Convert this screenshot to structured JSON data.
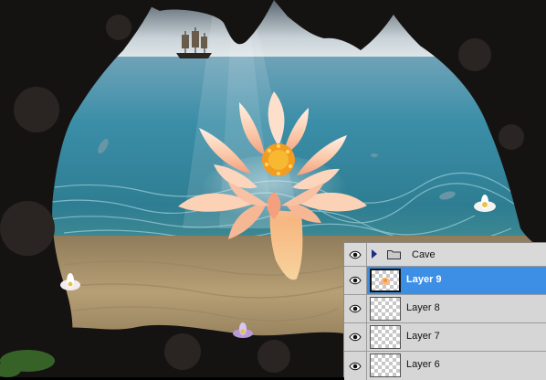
{
  "layers_panel": {
    "group": {
      "name": "Cave",
      "icon": "folder-icon",
      "expanded": false
    },
    "layers": [
      {
        "name": "Layer 9",
        "selected": true
      },
      {
        "name": "Layer 8",
        "selected": false
      },
      {
        "name": "Layer 7",
        "selected": false
      },
      {
        "name": "Layer 6",
        "selected": false
      }
    ]
  },
  "colors": {
    "selection": "#3d8fe6",
    "panel": "#d6d6d6"
  }
}
